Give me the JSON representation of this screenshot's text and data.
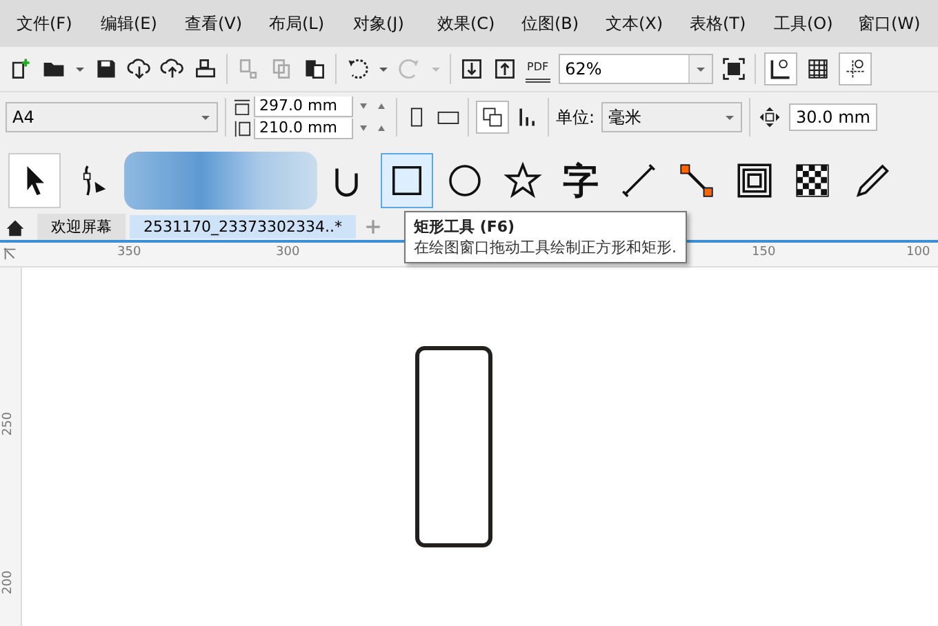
{
  "menu": [
    "文件(F)",
    "编辑(E)",
    "查看(V)",
    "布局(L)",
    "对象(J)",
    "效果(C)",
    "位图(B)",
    "文本(X)",
    "表格(T)",
    "工具(O)",
    "窗口(W)"
  ],
  "toolbar": {
    "pdf_label": "PDF",
    "zoom": "62%"
  },
  "property_bar": {
    "page_size": "A4",
    "width": "297.0 mm",
    "height": "210.0 mm",
    "unit_label": "单位:",
    "unit": "毫米",
    "nudge": "30.0 mm"
  },
  "toolbox": [
    {
      "kind": "pick",
      "selected": true,
      "hover": false
    },
    {
      "kind": "shape",
      "selected": false,
      "hover": false
    },
    {
      "kind": "blurred"
    },
    {
      "kind": "curve",
      "selected": false,
      "hover": false
    },
    {
      "kind": "rectangle",
      "selected": false,
      "hover": true
    },
    {
      "kind": "ellipse",
      "selected": false,
      "hover": false
    },
    {
      "kind": "star",
      "selected": false,
      "hover": false
    },
    {
      "kind": "text",
      "label": "字",
      "selected": false,
      "hover": false
    },
    {
      "kind": "line",
      "selected": false,
      "hover": false
    },
    {
      "kind": "connector",
      "selected": false,
      "hover": false
    },
    {
      "kind": "contour",
      "selected": false,
      "hover": false
    },
    {
      "kind": "transparency",
      "selected": false,
      "hover": false
    },
    {
      "kind": "pen",
      "selected": false,
      "hover": false
    }
  ],
  "tabs": [
    {
      "label": "欢迎屏幕",
      "selected": false
    },
    {
      "label": "2531170_23373302334..*",
      "selected": true
    }
  ],
  "tooltip": {
    "title": "矩形工具 (F6)",
    "description": "在绘图窗口拖动工具绘制正方形和矩形."
  },
  "top_ruler": [
    "350",
    "300",
    "150",
    "100"
  ],
  "left_ruler": [
    "250",
    "200"
  ]
}
